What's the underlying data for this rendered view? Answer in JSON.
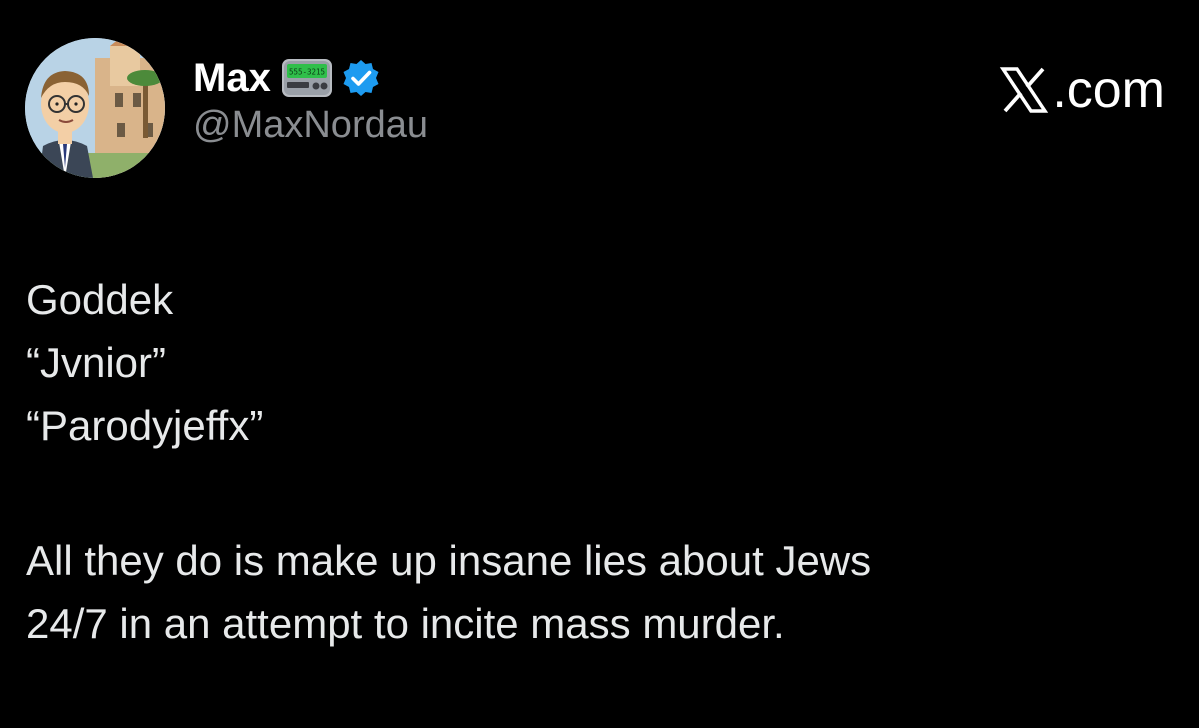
{
  "author": {
    "display_name": "Max",
    "handle": "@MaxNordau",
    "pager_text": "555-3215",
    "avatar_icon": "cartoon-man-avatar",
    "badge_icon": "verified-badge-icon",
    "badge_color": "#1d9bf0"
  },
  "site": {
    "label": ".com",
    "logo_icon": "x-logo-icon"
  },
  "post": {
    "lines": [
      "Goddek",
      "“Jvnior”",
      "“Parodyjeffx”"
    ],
    "paragraph": [
      "All they do is make up insane lies about Jews",
      "24/7 in an attempt to incite mass murder."
    ]
  },
  "colors": {
    "background": "#000000",
    "text": "#e7e9ea",
    "handle": "#8a8d91",
    "pager_screen": "#2fbf4a"
  }
}
